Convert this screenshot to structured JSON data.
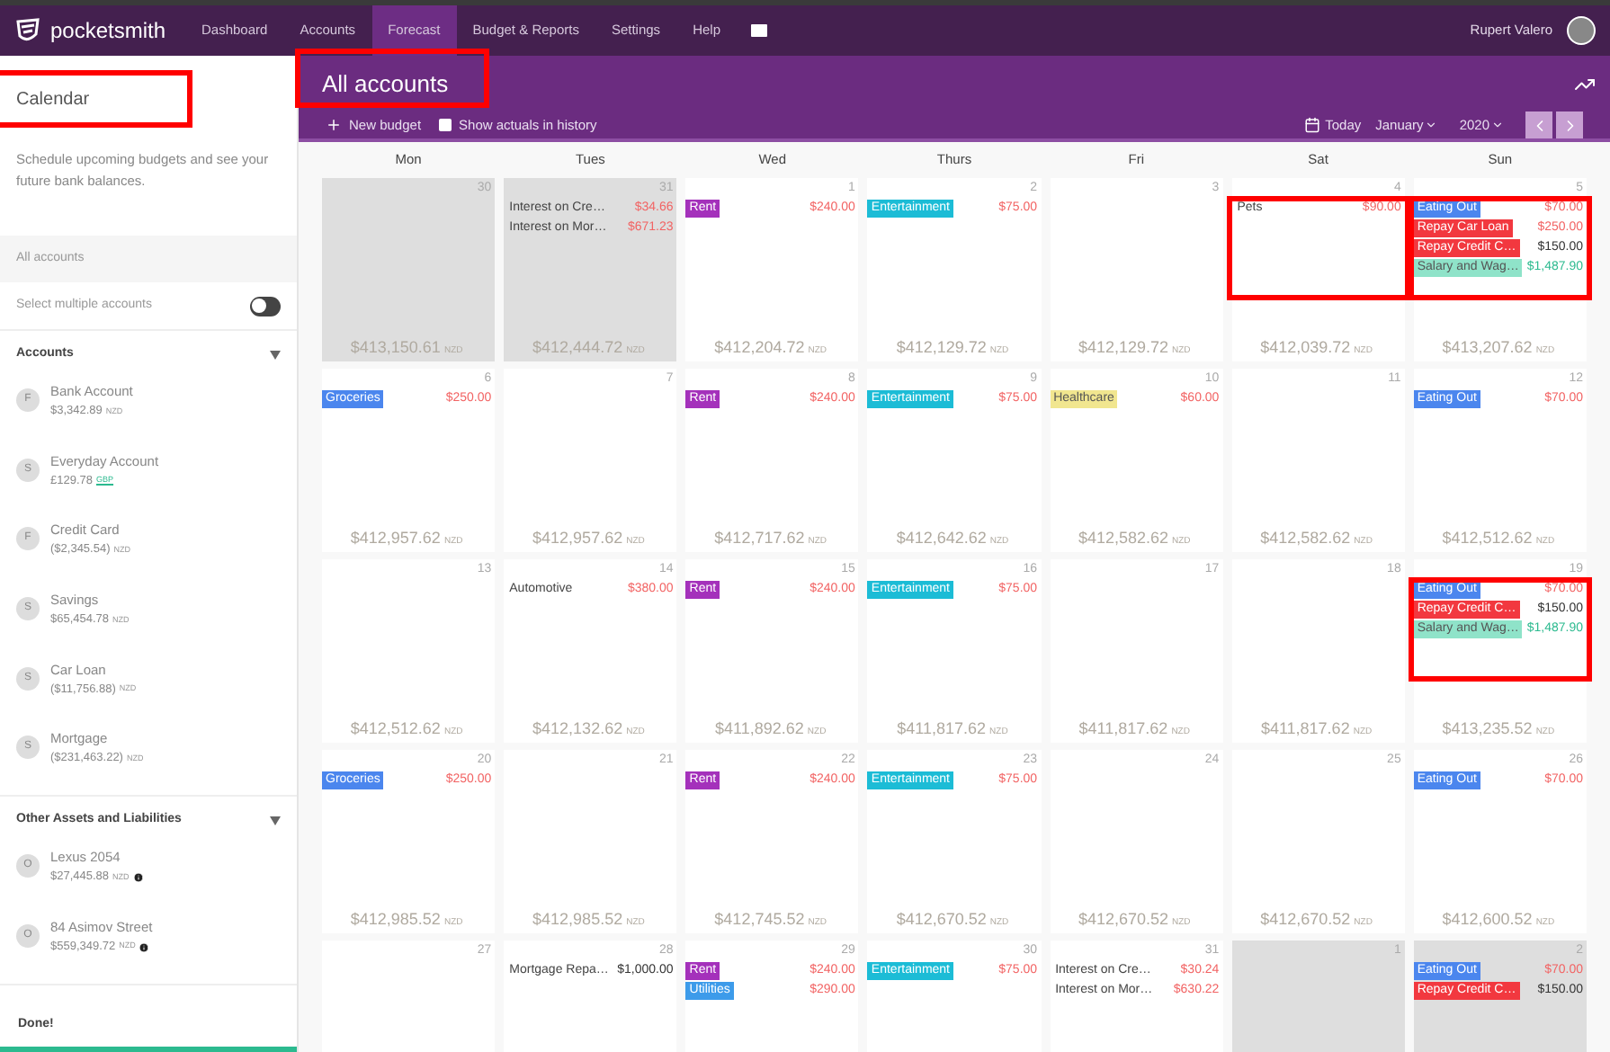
{
  "nav": {
    "brand": "pocketsmith",
    "items": [
      {
        "label": "Dashboard",
        "selected": false
      },
      {
        "label": "Accounts",
        "selected": false
      },
      {
        "label": "Forecast",
        "selected": true
      },
      {
        "label": "Budget & Reports",
        "selected": false
      },
      {
        "label": "Settings",
        "selected": false
      },
      {
        "label": "Help",
        "selected": false
      }
    ],
    "user": "Rupert Valero"
  },
  "sidebar": {
    "heading": "Calendar",
    "heading_annotated": true,
    "description": "Schedule upcoming budgets and see your future bank balances.",
    "all_accounts": {
      "label": "All accounts"
    },
    "multi_select": {
      "label": "Select multiple accounts",
      "on": false
    },
    "groups": [
      {
        "title": "Accounts",
        "expanded": true,
        "accounts": [
          {
            "initial": "F",
            "name": "Bank Account",
            "balance": "$3,342.89",
            "currency": "NZD",
            "currency_link": false,
            "info": false
          },
          {
            "initial": "S",
            "name": "Everyday Account",
            "balance": "£129.78",
            "currency": "GBP",
            "currency_link": true,
            "info": false
          },
          {
            "initial": "F",
            "name": "Credit Card",
            "balance": "($2,345.54)",
            "currency": "NZD",
            "currency_link": false,
            "info": false
          },
          {
            "initial": "S",
            "name": "Savings",
            "balance": "$65,454.78",
            "currency": "NZD",
            "currency_link": false,
            "info": false
          },
          {
            "initial": "S",
            "name": "Car Loan",
            "balance": "($11,756.88)",
            "currency": "NZD",
            "currency_link": false,
            "info": false
          },
          {
            "initial": "S",
            "name": "Mortgage",
            "balance": "($231,463.22)",
            "currency": "NZD",
            "currency_link": false,
            "info": false
          }
        ]
      },
      {
        "title": "Other Assets and Liabilities",
        "expanded": true,
        "accounts": [
          {
            "initial": "O",
            "name": "Lexus 2054",
            "balance": "$27,445.88",
            "currency": "NZD",
            "currency_link": false,
            "info": true
          },
          {
            "initial": "O",
            "name": "84 Asimov Street",
            "balance": "$559,349.72",
            "currency": "NZD",
            "currency_link": false,
            "info": true
          }
        ]
      }
    ],
    "done": "Done!"
  },
  "main": {
    "title": "All accounts",
    "title_annotated": true,
    "new_budget": "New budget",
    "show_actuals": {
      "label": "Show actuals in history",
      "checked": false
    },
    "today": "Today",
    "month": "January",
    "year": "2020",
    "weekdays": [
      "Mon",
      "Tues",
      "Wed",
      "Thurs",
      "Fri",
      "Sat",
      "Sun"
    ],
    "weeks": [
      {
        "days": [
          {
            "day": "30",
            "outside": true,
            "annotated": false,
            "balance": "$413,150.61",
            "currency": "NZD"
          },
          {
            "day": "31",
            "outside": true,
            "annotated": false,
            "balance": "$412,444.72",
            "currency": "NZD",
            "entries": [
              {
                "kind": "text",
                "label": "Interest on Cre…",
                "amount": {
                  "text": "$34.66",
                  "color": "#f26363"
                }
              },
              {
                "kind": "text",
                "label": "Interest on Mor…",
                "amount": {
                  "text": "$671.23",
                  "color": "#f26363"
                }
              }
            ]
          },
          {
            "day": "1",
            "outside": false,
            "annotated": false,
            "balance": "$412,204.72",
            "currency": "NZD",
            "entries": [
              {
                "kind": "tag",
                "label": "Rent",
                "color": "#a431bb",
                "amount": {
                  "text": "$240.00",
                  "color": "#f26363"
                }
              }
            ]
          },
          {
            "day": "2",
            "outside": false,
            "annotated": false,
            "balance": "$412,129.72",
            "currency": "NZD",
            "entries": [
              {
                "kind": "tag",
                "label": "Entertainment",
                "color": "#1cbcd6",
                "amount": {
                  "text": "$75.00",
                  "color": "#f26363"
                }
              }
            ]
          },
          {
            "day": "3",
            "outside": false,
            "annotated": false,
            "balance": "$412,129.72",
            "currency": "NZD"
          },
          {
            "day": "4",
            "outside": false,
            "annotated": true,
            "balance": "$412,039.72",
            "currency": "NZD",
            "entries": [
              {
                "kind": "text",
                "label": "Pets",
                "amount": {
                  "text": "$90.00",
                  "color": "#f26363"
                }
              }
            ]
          },
          {
            "day": "5",
            "outside": false,
            "annotated": true,
            "balance": "$413,207.62",
            "currency": "NZD",
            "entries": [
              {
                "kind": "tag",
                "label": "Eating Out",
                "color": "#4b86ee",
                "amount": {
                  "text": "$70.00",
                  "color": "#f26363"
                }
              },
              {
                "kind": "tag",
                "label": "Repay Car Loan",
                "color": "#f2383f",
                "amount": {
                  "text": "$250.00",
                  "color": "#f26363"
                }
              },
              {
                "kind": "tag",
                "label": "Repay Credit C…",
                "color": "#f2383f",
                "amount": {
                  "text": "$150.00",
                  "color": "#333333"
                }
              },
              {
                "kind": "tag",
                "label": "Salary and Wag…",
                "color": "#8fe3c9",
                "amount": {
                  "text": "$1,487.90",
                  "color": "#2cba8f"
                }
              }
            ]
          }
        ]
      },
      {
        "days": [
          {
            "day": "6",
            "outside": false,
            "annotated": false,
            "balance": "$412,957.62",
            "currency": "NZD",
            "entries": [
              {
                "kind": "tag",
                "label": "Groceries",
                "color": "#4b86ee",
                "amount": {
                  "text": "$250.00",
                  "color": "#f26363"
                }
              }
            ]
          },
          {
            "day": "7",
            "outside": false,
            "annotated": false,
            "balance": "$412,957.62",
            "currency": "NZD"
          },
          {
            "day": "8",
            "outside": false,
            "annotated": false,
            "balance": "$412,717.62",
            "currency": "NZD",
            "entries": [
              {
                "kind": "tag",
                "label": "Rent",
                "color": "#a431bb",
                "amount": {
                  "text": "$240.00",
                  "color": "#f26363"
                }
              }
            ]
          },
          {
            "day": "9",
            "outside": false,
            "annotated": false,
            "balance": "$412,642.62",
            "currency": "NZD",
            "entries": [
              {
                "kind": "tag",
                "label": "Entertainment",
                "color": "#1cbcd6",
                "amount": {
                  "text": "$75.00",
                  "color": "#f26363"
                }
              }
            ]
          },
          {
            "day": "10",
            "outside": false,
            "annotated": false,
            "balance": "$412,582.62",
            "currency": "NZD",
            "entries": [
              {
                "kind": "tag",
                "label": "Healthcare",
                "color": "#f1e68f",
                "amount": {
                  "text": "$60.00",
                  "color": "#f26363"
                }
              }
            ]
          },
          {
            "day": "11",
            "outside": false,
            "annotated": false,
            "balance": "$412,582.62",
            "currency": "NZD"
          },
          {
            "day": "12",
            "outside": false,
            "annotated": false,
            "balance": "$412,512.62",
            "currency": "NZD",
            "entries": [
              {
                "kind": "tag",
                "label": "Eating Out",
                "color": "#4b86ee",
                "amount": {
                  "text": "$70.00",
                  "color": "#f26363"
                }
              }
            ]
          }
        ]
      },
      {
        "days": [
          {
            "day": "13",
            "outside": false,
            "annotated": false,
            "balance": "$412,512.62",
            "currency": "NZD"
          },
          {
            "day": "14",
            "outside": false,
            "annotated": false,
            "balance": "$412,132.62",
            "currency": "NZD",
            "entries": [
              {
                "kind": "text",
                "label": "Automotive",
                "amount": {
                  "text": "$380.00",
                  "color": "#f26363"
                }
              }
            ]
          },
          {
            "day": "15",
            "outside": false,
            "annotated": false,
            "balance": "$411,892.62",
            "currency": "NZD",
            "entries": [
              {
                "kind": "tag",
                "label": "Rent",
                "color": "#a431bb",
                "amount": {
                  "text": "$240.00",
                  "color": "#f26363"
                }
              }
            ]
          },
          {
            "day": "16",
            "outside": false,
            "annotated": false,
            "balance": "$411,817.62",
            "currency": "NZD",
            "entries": [
              {
                "kind": "tag",
                "label": "Entertainment",
                "color": "#1cbcd6",
                "amount": {
                  "text": "$75.00",
                  "color": "#f26363"
                }
              }
            ]
          },
          {
            "day": "17",
            "outside": false,
            "annotated": false,
            "balance": "$411,817.62",
            "currency": "NZD"
          },
          {
            "day": "18",
            "outside": false,
            "annotated": false,
            "balance": "$411,817.62",
            "currency": "NZD"
          },
          {
            "day": "19",
            "outside": false,
            "annotated": true,
            "balance": "$413,235.52",
            "currency": "NZD",
            "entries": [
              {
                "kind": "tag",
                "label": "Eating Out",
                "color": "#4b86ee",
                "amount": {
                  "text": "$70.00",
                  "color": "#f26363"
                }
              },
              {
                "kind": "tag",
                "label": "Repay Credit C…",
                "color": "#f2383f",
                "amount": {
                  "text": "$150.00",
                  "color": "#333333"
                }
              },
              {
                "kind": "tag",
                "label": "Salary and Wag…",
                "color": "#8fe3c9",
                "amount": {
                  "text": "$1,487.90",
                  "color": "#2cba8f"
                }
              }
            ]
          }
        ]
      },
      {
        "days": [
          {
            "day": "20",
            "outside": false,
            "annotated": false,
            "balance": "$412,985.52",
            "currency": "NZD",
            "entries": [
              {
                "kind": "tag",
                "label": "Groceries",
                "color": "#4b86ee",
                "amount": {
                  "text": "$250.00",
                  "color": "#f26363"
                }
              }
            ]
          },
          {
            "day": "21",
            "outside": false,
            "annotated": false,
            "balance": "$412,985.52",
            "currency": "NZD"
          },
          {
            "day": "22",
            "outside": false,
            "annotated": false,
            "balance": "$412,745.52",
            "currency": "NZD",
            "entries": [
              {
                "kind": "tag",
                "label": "Rent",
                "color": "#a431bb",
                "amount": {
                  "text": "$240.00",
                  "color": "#f26363"
                }
              }
            ]
          },
          {
            "day": "23",
            "outside": false,
            "annotated": false,
            "balance": "$412,670.52",
            "currency": "NZD",
            "entries": [
              {
                "kind": "tag",
                "label": "Entertainment",
                "color": "#1cbcd6",
                "amount": {
                  "text": "$75.00",
                  "color": "#f26363"
                }
              }
            ]
          },
          {
            "day": "24",
            "outside": false,
            "annotated": false,
            "balance": "$412,670.52",
            "currency": "NZD"
          },
          {
            "day": "25",
            "outside": false,
            "annotated": false,
            "balance": "$412,670.52",
            "currency": "NZD"
          },
          {
            "day": "26",
            "outside": false,
            "annotated": false,
            "balance": "$412,600.52",
            "currency": "NZD",
            "entries": [
              {
                "kind": "tag",
                "label": "Eating Out",
                "color": "#4b86ee",
                "amount": {
                  "text": "$70.00",
                  "color": "#f26363"
                }
              }
            ]
          }
        ]
      },
      {
        "days": [
          {
            "day": "27",
            "outside": false,
            "annotated": false
          },
          {
            "day": "28",
            "outside": false,
            "annotated": false,
            "entries": [
              {
                "kind": "text",
                "label": "Mortgage Repa…",
                "amount": {
                  "text": "$1,000.00",
                  "color": "#333333"
                }
              }
            ]
          },
          {
            "day": "29",
            "outside": false,
            "annotated": false,
            "entries": [
              {
                "kind": "tag",
                "label": "Rent",
                "color": "#a431bb",
                "amount": {
                  "text": "$240.00",
                  "color": "#f26363"
                }
              },
              {
                "kind": "tag",
                "label": "Utilities",
                "color": "#3d9bea",
                "amount": {
                  "text": "$290.00",
                  "color": "#f26363"
                }
              }
            ]
          },
          {
            "day": "30",
            "outside": false,
            "annotated": false,
            "entries": [
              {
                "kind": "tag",
                "label": "Entertainment",
                "color": "#1cbcd6",
                "amount": {
                  "text": "$75.00",
                  "color": "#f26363"
                }
              }
            ]
          },
          {
            "day": "31",
            "outside": false,
            "annotated": false,
            "entries": [
              {
                "kind": "text",
                "label": "Interest on Cre…",
                "amount": {
                  "text": "$30.24",
                  "color": "#f26363"
                }
              },
              {
                "kind": "text",
                "label": "Interest on Mor…",
                "amount": {
                  "text": "$630.22",
                  "color": "#f26363"
                }
              }
            ]
          },
          {
            "day": "1",
            "outside": true,
            "annotated": false
          },
          {
            "day": "2",
            "outside": true,
            "annotated": false,
            "entries": [
              {
                "kind": "tag",
                "label": "Eating Out",
                "color": "#4b86ee",
                "amount": {
                  "text": "$70.00",
                  "color": "#f26363"
                }
              },
              {
                "kind": "tag",
                "label": "Repay Credit C…",
                "color": "#f2383f",
                "amount": {
                  "text": "$150.00",
                  "color": "#333333"
                }
              }
            ]
          }
        ]
      }
    ]
  }
}
